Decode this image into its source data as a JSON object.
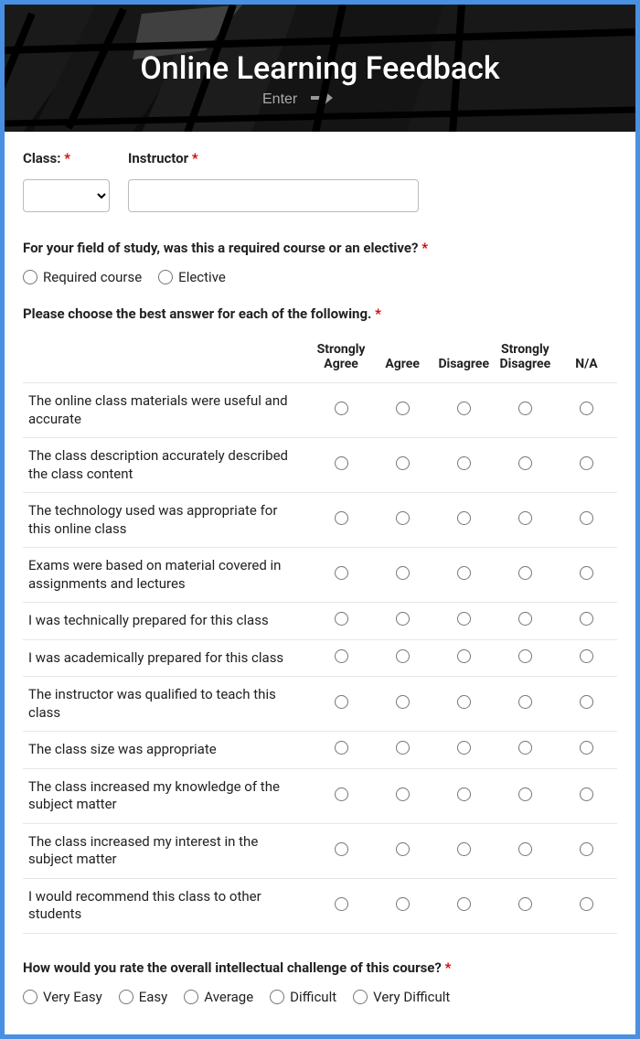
{
  "header": {
    "title": "Online Learning Feedback"
  },
  "fields": {
    "class_label": "Class:",
    "instructor_label": "Instructor"
  },
  "q_course_type": {
    "text": "For your field of study, was this a required course or an elective?",
    "options": [
      "Required course",
      "Elective"
    ]
  },
  "matrix": {
    "prompt": "Please choose the best answer for each of the following.",
    "columns": [
      "Strongly Agree",
      "Agree",
      "Disagree",
      "Strongly Disagree",
      "N/A"
    ],
    "rows": [
      "The online class materials were useful and accurate",
      "The class description accurately described the class content",
      "The technology used was appropriate for this online class",
      "Exams were based on material covered in assignments and lectures",
      "I was technically prepared for this class",
      "I was academically prepared for this class",
      "The instructor was qualified to teach this class",
      "The class size was appropriate",
      "The class increased my knowledge of the subject matter",
      "The class increased my interest in the subject matter",
      "I would recommend this class to other students"
    ]
  },
  "q_challenge": {
    "text": "How would you rate the overall intellectual challenge of this course?",
    "options": [
      "Very Easy",
      "Easy",
      "Average",
      "Difficult",
      "Very Difficult"
    ]
  }
}
